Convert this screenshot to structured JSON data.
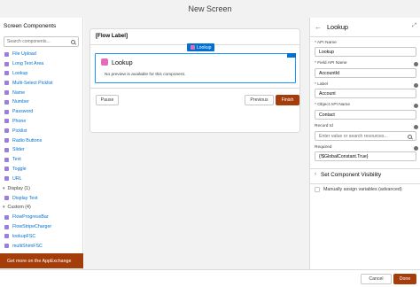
{
  "window": {
    "title": "New Screen"
  },
  "left_panel": {
    "heading": "Screen Components",
    "search_placeholder": "Search components...",
    "input_items": [
      {
        "label": "File Upload"
      },
      {
        "label": "Long Text Area"
      },
      {
        "label": "Lookup"
      },
      {
        "label": "Multi-Select Picklist"
      },
      {
        "label": "Name"
      },
      {
        "label": "Number"
      },
      {
        "label": "Password"
      },
      {
        "label": "Phone"
      },
      {
        "label": "Picklist"
      },
      {
        "label": "Radio Buttons"
      },
      {
        "label": "Slider"
      },
      {
        "label": "Text"
      },
      {
        "label": "Toggle"
      },
      {
        "label": "URL"
      }
    ],
    "display_section": {
      "label": "Display (1)",
      "items": [
        {
          "label": "Display Text"
        }
      ]
    },
    "custom_section": {
      "label": "Custom (4)",
      "items": [
        {
          "label": "FlowProgressBar"
        },
        {
          "label": "FlowStripeCharger"
        },
        {
          "label": "lookupFSC"
        },
        {
          "label": "multiShimFSC"
        }
      ]
    },
    "appexchange_label": "Get more on the AppExchange"
  },
  "canvas": {
    "flow_label": "[Flow Label]",
    "selected_tag": "Lookup",
    "component_title": "Lookup",
    "preview_note": "No preview is available for this component.",
    "pause_label": "Pause",
    "previous_label": "Previous",
    "finish_label": "Finish"
  },
  "right_panel": {
    "title": "Lookup",
    "api_name_label": "* API Name",
    "api_name_value": "Lookup",
    "field_api_name_label": "* Field API Name",
    "field_api_name_value": "AccountId",
    "label_label": "* Label",
    "label_value": "Account",
    "object_api_name_label": "* Object API Name",
    "object_api_name_value": "Contact",
    "record_id_label": "Record Id",
    "record_id_placeholder": "Enter value or search resources...",
    "required_label": "Required",
    "required_value": "{!$GlobalConstant.True}",
    "visibility_section": "Set Component Visibility",
    "manual_assign_label": "Manually assign variables (advanced)"
  },
  "footer": {
    "cancel_label": "Cancel",
    "done_label": "Done"
  },
  "colors": {
    "brand": "#a53d0a",
    "link": "#0070d2",
    "selection": "#1b96ff",
    "component_icon": "#9a7ede",
    "lookup_icon": "#e36db6"
  }
}
